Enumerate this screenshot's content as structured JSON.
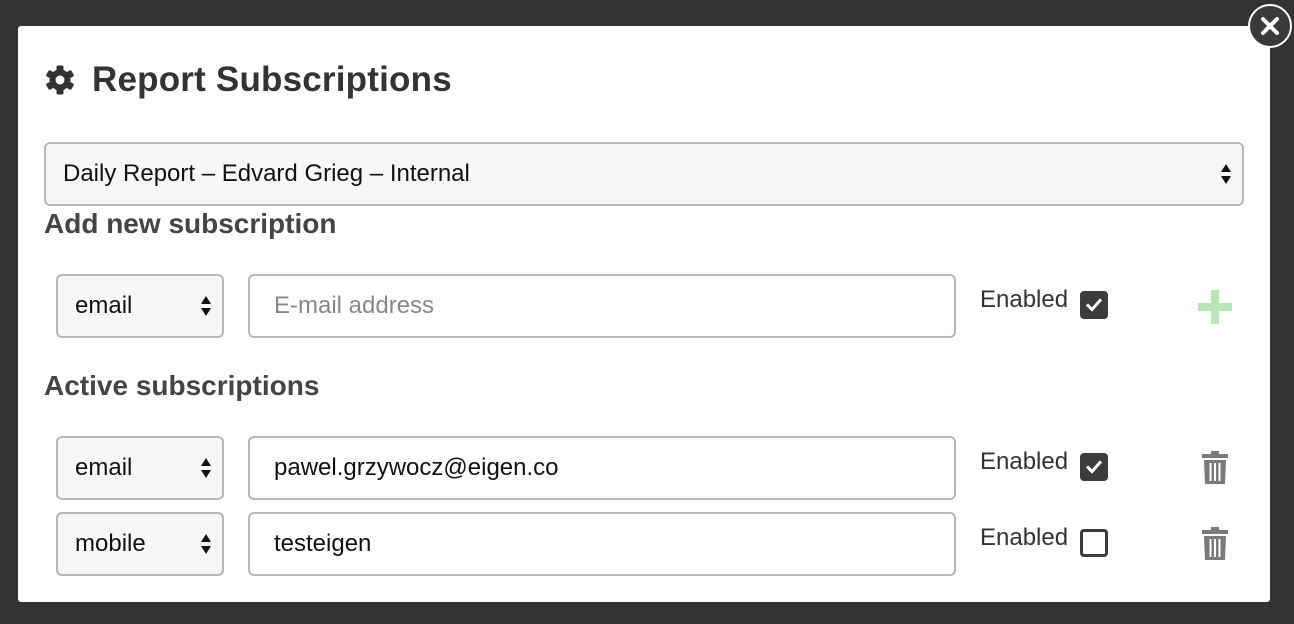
{
  "dialog": {
    "title": "Report Subscriptions",
    "icons": {
      "title": "gear-icon",
      "close": "close-icon"
    }
  },
  "report_select": {
    "value": "Daily Report – Edvard Grieg – Internal"
  },
  "add_section": {
    "heading": "Add new subscription",
    "type": "email",
    "input_value": "",
    "placeholder": "E-mail address",
    "enabled_label": "Enabled",
    "enabled": true,
    "add_icon": "plus-icon",
    "add_color": "#b9e6b5"
  },
  "active_section": {
    "heading": "Active subscriptions",
    "items": [
      {
        "type": "email",
        "value": "pawel.grzywocz@eigen.co",
        "enabled_label": "Enabled",
        "enabled": true,
        "delete_icon": "trash-icon"
      },
      {
        "type": "mobile",
        "value": "testeigen",
        "enabled_label": "Enabled",
        "enabled": false,
        "delete_icon": "trash-icon"
      }
    ]
  }
}
